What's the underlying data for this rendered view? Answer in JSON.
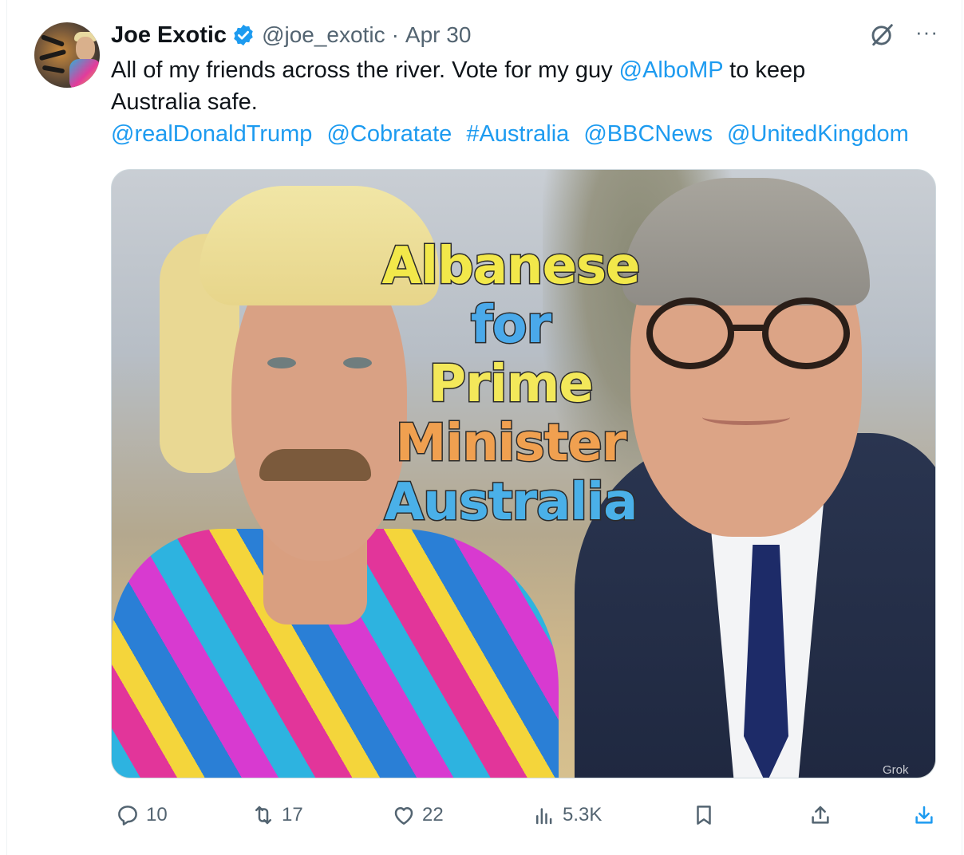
{
  "tweet": {
    "display_name": "Joe Exotic",
    "handle": "@joe_exotic",
    "separator": "·",
    "date": "Apr 30",
    "more_label": "···",
    "text_line1_a": "All of my friends across the river. Vote for my guy ",
    "text_mention": "@AlboMP",
    "text_line1_b": " to keep",
    "text_line2": "Australia safe.",
    "tags": [
      "@realDonaldTrump",
      "@Cobratate",
      "#Australia",
      "@BBCNews",
      "@UnitedKingdom"
    ]
  },
  "media": {
    "overlay_words": [
      "Albanese",
      "for",
      "Prime",
      "Minister",
      "Australia"
    ],
    "watermark": "Grok"
  },
  "actions": {
    "replies": "10",
    "reposts": "17",
    "likes": "22",
    "views": "5.3K"
  },
  "colors": {
    "link": "#1d9bf0",
    "muted": "#536471",
    "verified": "#1d9bf0"
  }
}
